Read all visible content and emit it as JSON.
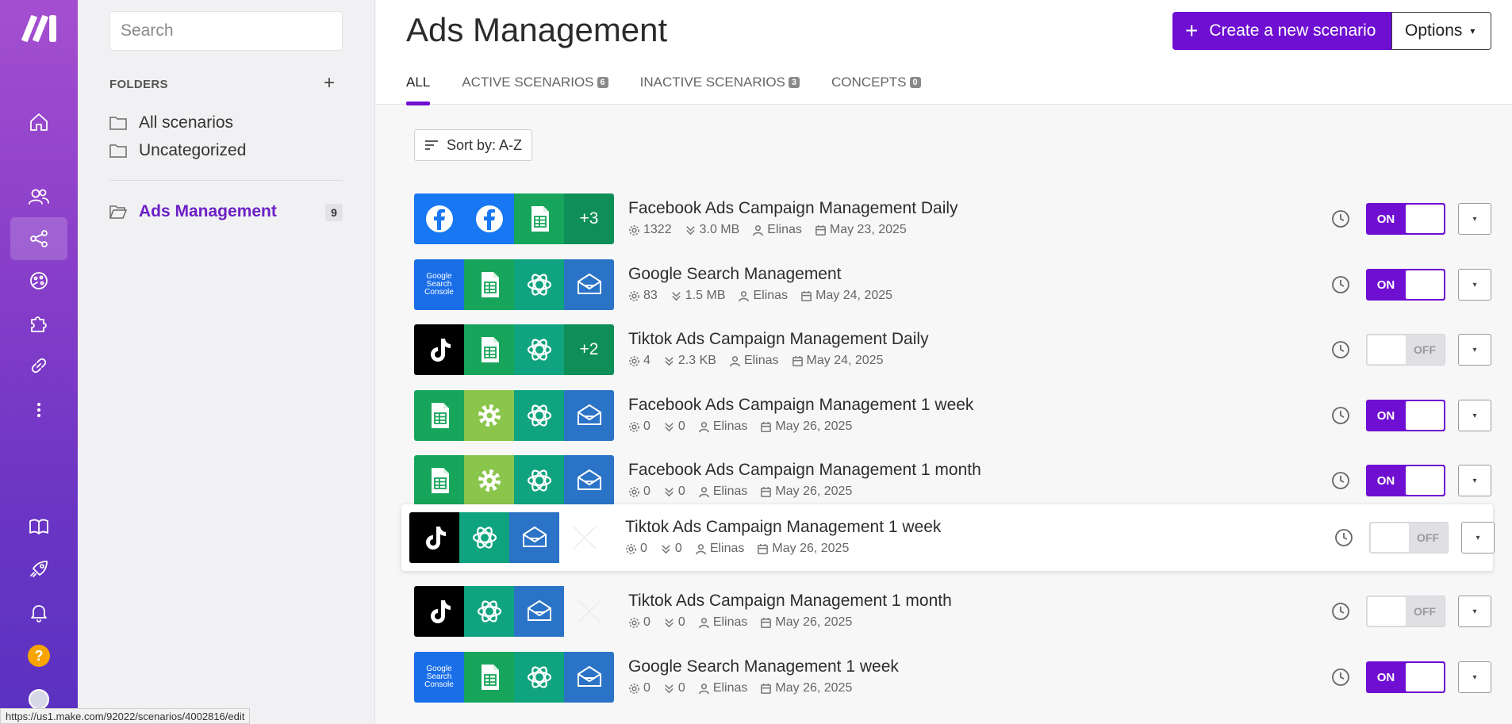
{
  "rail": {
    "items": [
      "home-icon",
      "team-icon",
      "scenarios-icon",
      "templates-icon",
      "apps-icon",
      "connections-icon",
      "more-icon"
    ],
    "bottom": [
      "docs-icon",
      "rocket-icon",
      "bell-icon",
      "help-icon",
      "avatar"
    ],
    "help_label": "?"
  },
  "folders": {
    "search_placeholder": "Search",
    "header": "FOLDERS",
    "add": "+",
    "items": [
      {
        "label": "All scenarios"
      },
      {
        "label": "Uncategorized"
      }
    ],
    "selected": {
      "label": "Ads Management",
      "count": "9"
    }
  },
  "header": {
    "title": "Ads Management",
    "create_label": "Create a new scenario",
    "create_plus": "+",
    "options_label": "Options",
    "caret": "▾"
  },
  "tabs": [
    {
      "label": "ALL",
      "badge": ""
    },
    {
      "label": "ACTIVE SCENARIOS",
      "badge": "6"
    },
    {
      "label": "INACTIVE SCENARIOS",
      "badge": "3"
    },
    {
      "label": "CONCEPTS",
      "badge": "0"
    }
  ],
  "sort_label": "Sort by: A-Z",
  "scenarios": [
    {
      "name": "Facebook Ads Campaign Management Daily",
      "ops": "1322",
      "data": "3.0 MB",
      "owner": "Elinas",
      "date": "May 23, 2025",
      "status": "ON"
    },
    {
      "name": "Google Search Management",
      "ops": "83",
      "data": "1.5 MB",
      "owner": "Elinas",
      "date": "May 24, 2025",
      "status": "ON"
    },
    {
      "name": "Tiktok Ads Campaign Management Daily",
      "ops": "4",
      "data": "2.3 KB",
      "owner": "Elinas",
      "date": "May 24, 2025",
      "status": "OFF"
    },
    {
      "name": "Facebook Ads Campaign Management 1 week",
      "ops": "0",
      "data": "0",
      "owner": "Elinas",
      "date": "May 26, 2025",
      "status": "ON"
    },
    {
      "name": "Facebook Ads Campaign Management 1 month",
      "ops": "0",
      "data": "0",
      "owner": "Elinas",
      "date": "May 26, 2025",
      "status": "ON"
    },
    {
      "name": "Tiktok Ads Campaign Management 1 week",
      "ops": "0",
      "data": "0",
      "owner": "Elinas",
      "date": "May 26, 2025",
      "status": "OFF"
    },
    {
      "name": "Tiktok Ads Campaign Management 1 month",
      "ops": "0",
      "data": "0",
      "owner": "Elinas",
      "date": "May 26, 2025",
      "status": "OFF"
    },
    {
      "name": "Google Search Management 1 week",
      "ops": "0",
      "data": "0",
      "owner": "Elinas",
      "date": "May 26, 2025",
      "status": "ON"
    }
  ],
  "module_more": [
    "+3",
    "+2"
  ],
  "gsc_label": "Google\nSearch Console",
  "status_url": "https://us1.make.com/92022/scenarios/4002816/edit",
  "colors": {
    "accent": "#6f0fd1",
    "facebook": "#1877f2",
    "sheets": "#17a55b",
    "openai": "#10a37f",
    "email": "#2a73c7",
    "tiktok": "#000000"
  }
}
